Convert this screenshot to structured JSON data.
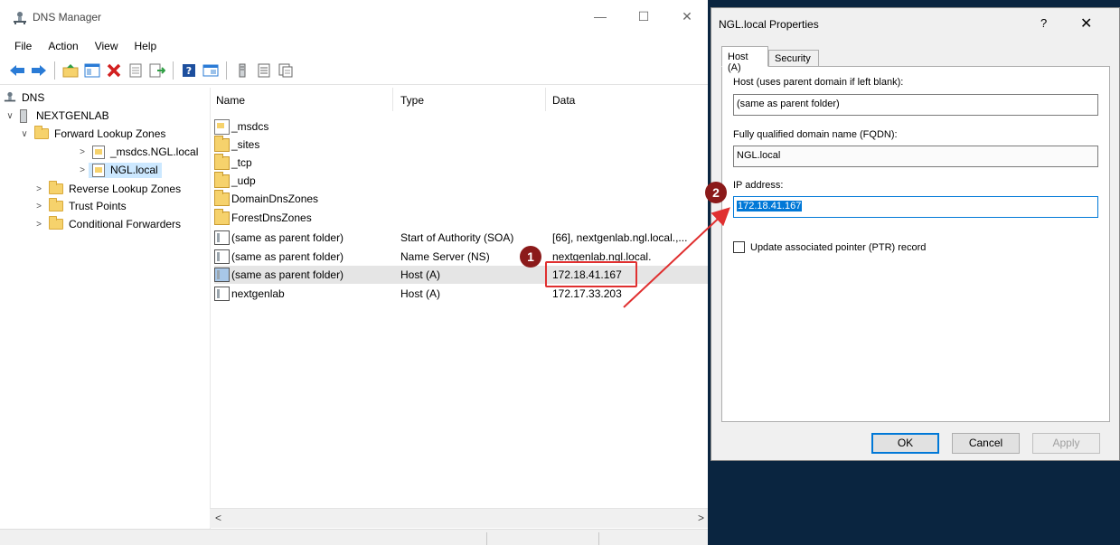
{
  "dns_manager": {
    "title": "DNS Manager",
    "window_controls": {
      "minimize": "—",
      "maximize": "☐",
      "close": "✕"
    },
    "menu": [
      "File",
      "Action",
      "View",
      "Help"
    ],
    "toolbar_icons": [
      "back-arrow-icon",
      "forward-arrow-icon",
      "up-folder-icon",
      "show-hide-tree-icon",
      "delete-icon",
      "properties-icon",
      "export-icon",
      "help-icon",
      "console-icon",
      "server-icon",
      "list-icon",
      "filter-icon"
    ],
    "tree": {
      "root": "DNS",
      "server": "NEXTGENLAB",
      "forward_zones": "Forward Lookup Zones",
      "msdcs_zone": "_msdcs.NGL.local",
      "ngl_zone": "NGL.local",
      "reverse_zones": "Reverse Lookup Zones",
      "trust_points": "Trust Points",
      "conditional_forwarders": "Conditional Forwarders"
    },
    "list": {
      "columns": [
        "Name",
        "Type",
        "Data"
      ],
      "rows": [
        {
          "name": "_msdcs",
          "type": "",
          "data": "",
          "icon": "zone-folder"
        },
        {
          "name": "_sites",
          "type": "",
          "data": "",
          "icon": "folder"
        },
        {
          "name": "_tcp",
          "type": "",
          "data": "",
          "icon": "folder"
        },
        {
          "name": "_udp",
          "type": "",
          "data": "",
          "icon": "folder"
        },
        {
          "name": "DomainDnsZones",
          "type": "",
          "data": "",
          "icon": "folder"
        },
        {
          "name": "ForestDnsZones",
          "type": "",
          "data": "",
          "icon": "folder"
        },
        {
          "name": "(same as parent folder)",
          "type": "Start of Authority (SOA)",
          "data": "[66], nextgenlab.ngl.local.,...",
          "icon": "record"
        },
        {
          "name": "(same as parent folder)",
          "type": "Name Server (NS)",
          "data": "nextgenlab.ngl.local.",
          "icon": "record"
        },
        {
          "name": "(same as parent folder)",
          "type": "Host (A)",
          "data": "172.18.41.167",
          "icon": "record",
          "selected": true
        },
        {
          "name": "nextgenlab",
          "type": "Host (A)",
          "data": "172.17.33.203",
          "icon": "record"
        }
      ]
    },
    "scroll": {
      "left": "<",
      "right": ">"
    }
  },
  "properties_dialog": {
    "title": "NGL.local Properties",
    "help": "?",
    "close": "✕",
    "tabs": [
      "Host (A)",
      "Security"
    ],
    "host_label": "Host (uses parent domain if left blank):",
    "host_value": "(same as parent folder)",
    "fqdn_label": "Fully qualified domain name (FQDN):",
    "fqdn_value": "NGL.local",
    "ip_label": "IP address:",
    "ip_value": "172.18.41.167",
    "ptr_checkbox_label": "Update associated pointer (PTR) record",
    "buttons": {
      "ok": "OK",
      "cancel": "Cancel",
      "apply": "Apply"
    }
  },
  "callouts": [
    "1",
    "2"
  ],
  "colors": {
    "callout": "#8b1a1a",
    "highlight": "#e03030",
    "selection": "#0078d7"
  }
}
